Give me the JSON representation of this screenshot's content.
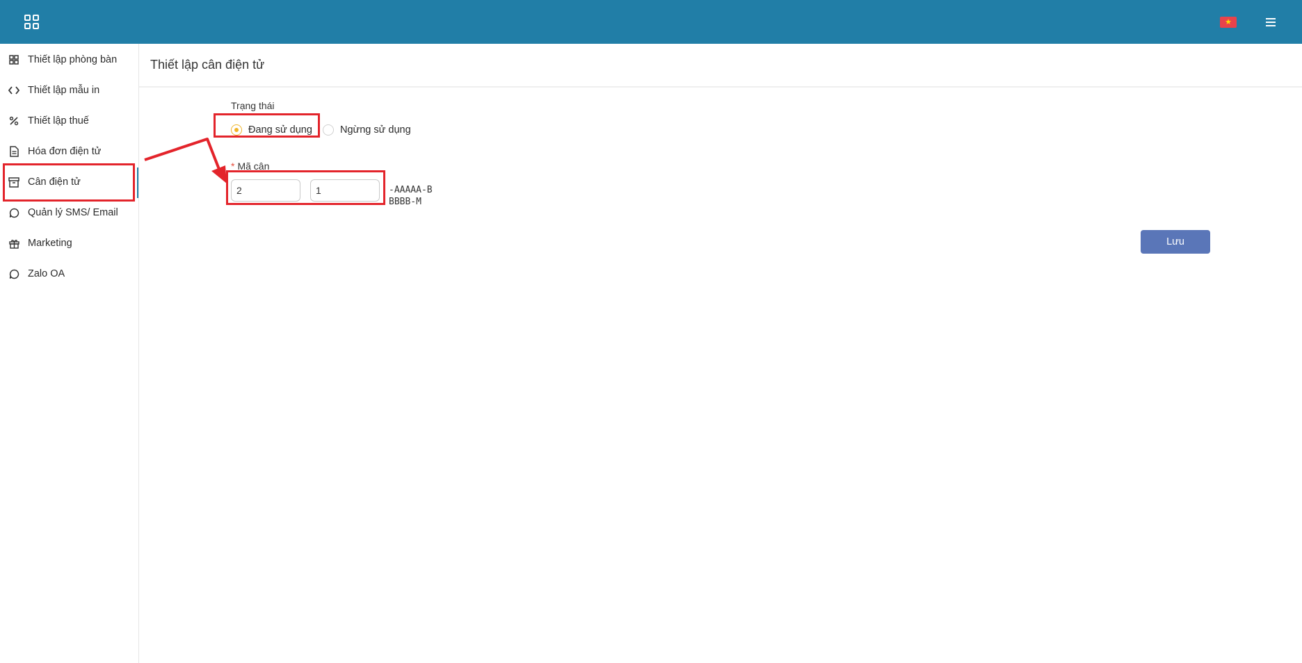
{
  "topbar": {
    "apps_icon": "apps-grid-icon",
    "flag_icon": "vietnam-flag-icon",
    "flag_star": "★",
    "menu_icon": "hamburger-menu-icon",
    "color": "#217ea7"
  },
  "sidebar": {
    "items": [
      {
        "label": "Thiết lập phòng bàn",
        "icon": "grid-icon"
      },
      {
        "label": "Thiết lập mẫu in",
        "icon": "code-icon"
      },
      {
        "label": "Thiết lập thuế",
        "icon": "percent-icon"
      },
      {
        "label": "Hóa đơn điện tử",
        "icon": "document-icon"
      },
      {
        "label": "Cân điện tử",
        "icon": "archive-icon",
        "active": true
      },
      {
        "label": "Quản lý SMS/ Email",
        "icon": "chat-icon"
      },
      {
        "label": "Marketing",
        "icon": "gift-icon"
      },
      {
        "label": "Zalo OA",
        "icon": "chat-icon"
      }
    ]
  },
  "page": {
    "title": "Thiết lập cân điện tử"
  },
  "form": {
    "status_label": "Trạng thái",
    "status_options": [
      {
        "label": "Đang sử dụng",
        "checked": true
      },
      {
        "label": "Ngừng sử dụng",
        "checked": false
      }
    ],
    "code_required_mark": "*",
    "code_label": "Mã cân",
    "code_part1": "2",
    "code_part2": "1",
    "code_suffix": "-AAAAA-BBBBB-M",
    "save_label": "Lưu"
  },
  "colors": {
    "accent": "#217ea7",
    "save_button": "#5a76b8",
    "radio_checked": "#f0b429",
    "annotation": "#e3242b"
  }
}
